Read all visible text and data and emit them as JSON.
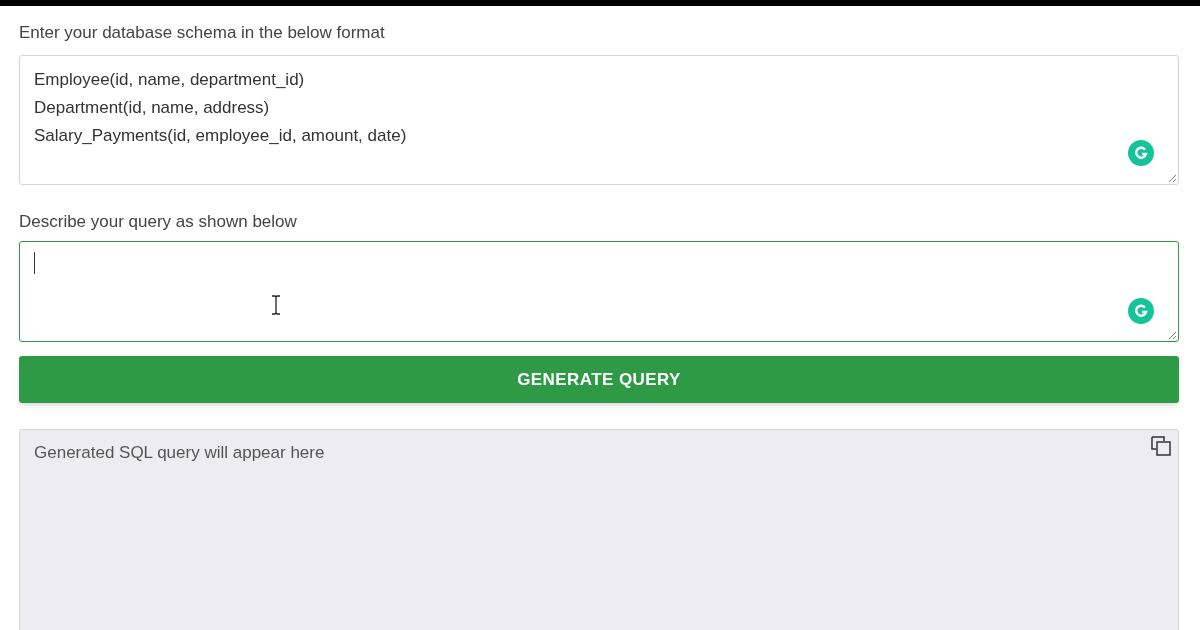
{
  "schema": {
    "label": "Enter your database schema in the below format",
    "value": [
      "Employee(id, name, department_id)",
      "Department(id, name, address)",
      "Salary_Payments(id, employee_id, amount, date)"
    ]
  },
  "query": {
    "label": "Describe your query as shown below",
    "focused": true
  },
  "generate_button": {
    "label": "GENERATE QUERY"
  },
  "output": {
    "placeholder": "Generated SQL query will appear here"
  }
}
